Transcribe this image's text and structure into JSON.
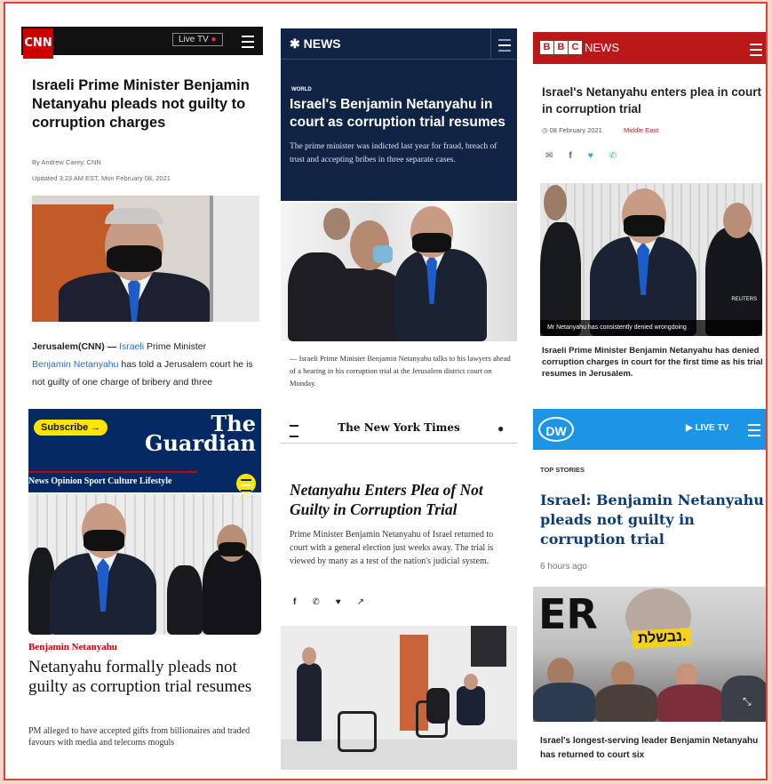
{
  "cnn": {
    "logo": "CNN",
    "live_tv": "Live TV",
    "title": "Israeli Prime Minister Benjamin Netanyahu pleads not guilty to corruption charges",
    "byline": "By Andrew Carey, CNN",
    "updated": "Updated 3:23 AM EST, Mon February 08, 2021",
    "body_prefix": "Jerusalem(CNN) —",
    "body_link1": "Israeli",
    "body_mid": "Prime Minister",
    "body_link2": "Benjamin Netanyahu",
    "body_rest": "has told a Jerusalem court he is not guilty of one charge of bribery and three"
  },
  "nbc": {
    "logo": "NEWS",
    "kicker": "WORLD",
    "title": "Israel's Benjamin Netanyahu in court as corruption trial resumes",
    "dek": "The prime minister was indicted last year for fraud, breach of trust and accepting bribes in three separate cases.",
    "caption": "— Israeli Prime Minister Benjamin Netanyahu talks to his lawyers ahead of a hearing in his corruption trial at the Jerusalem district court on Monday."
  },
  "bbc": {
    "blocks": [
      "B",
      "B",
      "C"
    ],
    "news": "NEWS",
    "title": "Israel's Netanyahu enters plea in court in corruption trial",
    "date": "08 February 2021",
    "category": "Middle East",
    "photo_credit": "REUTERS",
    "photo_caption": "Mr Netanyahu has consistently denied wrongdoing",
    "caption": "Israeli Prime Minister Benjamin Netanyahu has denied corruption charges in court for the first time as his trial resumes in Jerusalem."
  },
  "guardian": {
    "subscribe": "Subscribe →",
    "logo_line1": "The",
    "logo_line2": "Guardian",
    "nav": "News  Opinion  Sport  Culture  Lifestyle",
    "kicker": "Benjamin Netanyahu",
    "title": "Netanyahu formally pleads not guilty as corruption trial resumes",
    "dek": "PM alleged to have accepted gifts from billionaires and traded favours with media and telecoms moguls"
  },
  "nyt": {
    "logo": "The New York Times",
    "title": "Netanyahu Enters Plea of Not Guilty in Corruption Trial",
    "dek": "Prime Minister Benjamin Netanyahu of Israel returned to court with a general election just weeks away. The trial is viewed by many as a test of the nation's judicial system."
  },
  "dw": {
    "logo": "DW",
    "live_tv": "▶ LIVE TV",
    "kicker": "TOP STORIES",
    "title": "Israel: Benjamin Netanyahu pleads not guilty in corruption trial",
    "time": "6 hours ago",
    "sign_text": "נבשלת.",
    "big_letters": "ER",
    "caption": "Israel's longest-serving leader Benjamin Netanyahu has returned to court six"
  },
  "colors": {
    "frame": "#d6453a",
    "cnn_red": "#cc0000",
    "nbc_navy": "#0f2445",
    "bbc_red": "#bb1919",
    "guardian_blue": "#052962",
    "guardian_yellow": "#ffe500",
    "dw_blue": "#1c95e6",
    "link_blue": "#2a6bbf"
  }
}
